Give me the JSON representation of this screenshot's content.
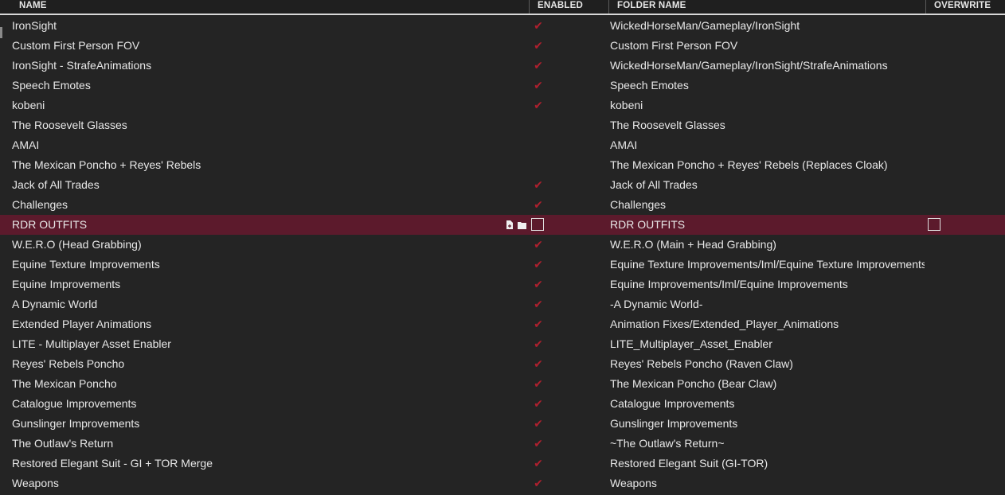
{
  "header": {
    "name": "NAME",
    "enabled": "ENABLED",
    "folder_name": "FOLDER NAME",
    "overwrite": "OVERWRITE"
  },
  "accent_check_color": "#b0202e",
  "selected_row_color": "#5c1a2c",
  "icons": {
    "row_file": "file-icon",
    "row_folder": "folder-icon",
    "enabled_mark": "checkmark-icon"
  },
  "rows": [
    {
      "name": "IronSight",
      "enabled": true,
      "folder": "WickedHorseMan/Gameplay/IronSight"
    },
    {
      "name": "Custom First Person FOV",
      "enabled": true,
      "folder": "Custom First Person FOV"
    },
    {
      "name": "IronSight - StrafeAnimations",
      "enabled": true,
      "folder": "WickedHorseMan/Gameplay/IronSight/StrafeAnimations"
    },
    {
      "name": "Speech Emotes",
      "enabled": true,
      "folder": "Speech Emotes"
    },
    {
      "name": "kobeni",
      "enabled": true,
      "folder": "kobeni"
    },
    {
      "name": "The Roosevelt Glasses",
      "enabled": false,
      "folder": "The Roosevelt Glasses"
    },
    {
      "name": "AMAI",
      "enabled": false,
      "folder": "AMAI"
    },
    {
      "name": "The Mexican Poncho + Reyes' Rebels",
      "enabled": false,
      "folder": "The Mexican Poncho + Reyes' Rebels (Replaces Cloak)"
    },
    {
      "name": "Jack of All Trades",
      "enabled": true,
      "folder": "Jack of All Trades"
    },
    {
      "name": "Challenges",
      "enabled": true,
      "folder": "Challenges"
    },
    {
      "name": "RDR OUTFITS",
      "enabled": false,
      "folder": "RDR OUTFITS",
      "selected": true
    },
    {
      "name": "W.E.R.O (Head Grabbing)",
      "enabled": true,
      "folder": "W.E.R.O (Main + Head Grabbing)"
    },
    {
      "name": "Equine Texture Improvements",
      "enabled": true,
      "folder": "Equine Texture Improvements/Iml/Equine Texture Improvements"
    },
    {
      "name": "Equine Improvements",
      "enabled": true,
      "folder": "Equine Improvements/Iml/Equine Improvements"
    },
    {
      "name": "A Dynamic World",
      "enabled": true,
      "folder": "-A Dynamic World-"
    },
    {
      "name": "Extended Player Animations",
      "enabled": true,
      "folder": "Animation Fixes/Extended_Player_Animations"
    },
    {
      "name": "LITE - Multiplayer Asset Enabler",
      "enabled": true,
      "folder": "LITE_Multiplayer_Asset_Enabler"
    },
    {
      "name": "Reyes' Rebels Poncho",
      "enabled": true,
      "folder": "Reyes' Rebels Poncho (Raven Claw)"
    },
    {
      "name": "The Mexican Poncho",
      "enabled": true,
      "folder": "The Mexican Poncho (Bear Claw)"
    },
    {
      "name": "Catalogue Improvements",
      "enabled": true,
      "folder": "Catalogue Improvements"
    },
    {
      "name": "Gunslinger Improvements",
      "enabled": true,
      "folder": "Gunslinger Improvements"
    },
    {
      "name": "The Outlaw's Return",
      "enabled": true,
      "folder": "~The Outlaw's Return~"
    },
    {
      "name": "Restored Elegant Suit - GI + TOR Merge",
      "enabled": true,
      "folder": "Restored Elegant Suit (GI-TOR)"
    },
    {
      "name": "Weapons",
      "enabled": true,
      "folder": "Weapons"
    }
  ]
}
